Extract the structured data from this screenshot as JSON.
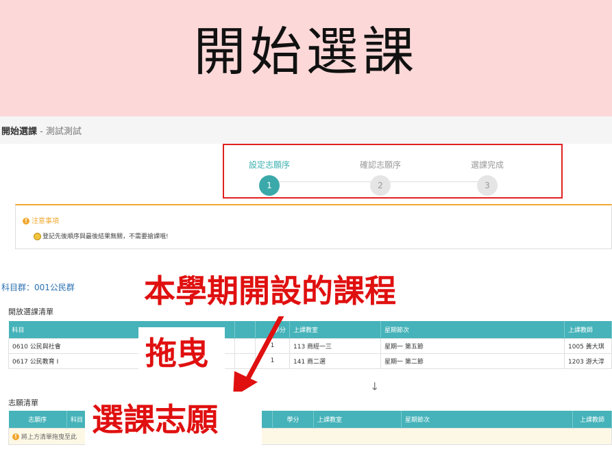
{
  "banner": {
    "title": "開始選課"
  },
  "header": {
    "title_bold": "開始選課",
    "title_sub": " - 測試測試"
  },
  "steps": [
    {
      "label": "設定志願序",
      "number": "1",
      "active": true
    },
    {
      "label": "確認志願序",
      "number": "2",
      "active": false
    },
    {
      "label": "選課完成",
      "number": "3",
      "active": false
    }
  ],
  "notice": {
    "title": "注意事項",
    "body": "登記先後順序與最後結果無關，不需要搶課哦!"
  },
  "group_label": "科目群：001公民群",
  "open_list": {
    "title": "開放選課清單",
    "columns": [
      "科目",
      "",
      "學分",
      "上課教室",
      "星期節次",
      "上課教師"
    ],
    "rows": [
      [
        "0610 公民與社會",
        "",
        "1",
        "113 商經一三",
        "星期一 第五節",
        "1005 黃大琪"
      ],
      [
        "0617 公民教育 I",
        "",
        "1",
        "141 商二選",
        "星期一 第二節",
        "1203 游大淳"
      ]
    ]
  },
  "wish_list": {
    "title": "志願清單",
    "columns": [
      "志願序",
      "科目",
      "",
      "學分",
      "上課教室",
      "星期節次",
      "上課教師"
    ],
    "empty_text": "將上方清單拖曳至此"
  },
  "annotations": {
    "callout1": "本學期開設的課程",
    "callout2": "拖曳",
    "callout3": "選課志願",
    "arrow_color": "#e01010"
  },
  "colors": {
    "accent": "#45b3b9",
    "step_active": "#3ba9a9",
    "warning": "#f0a830",
    "banner_bg": "#fcd8d8"
  }
}
